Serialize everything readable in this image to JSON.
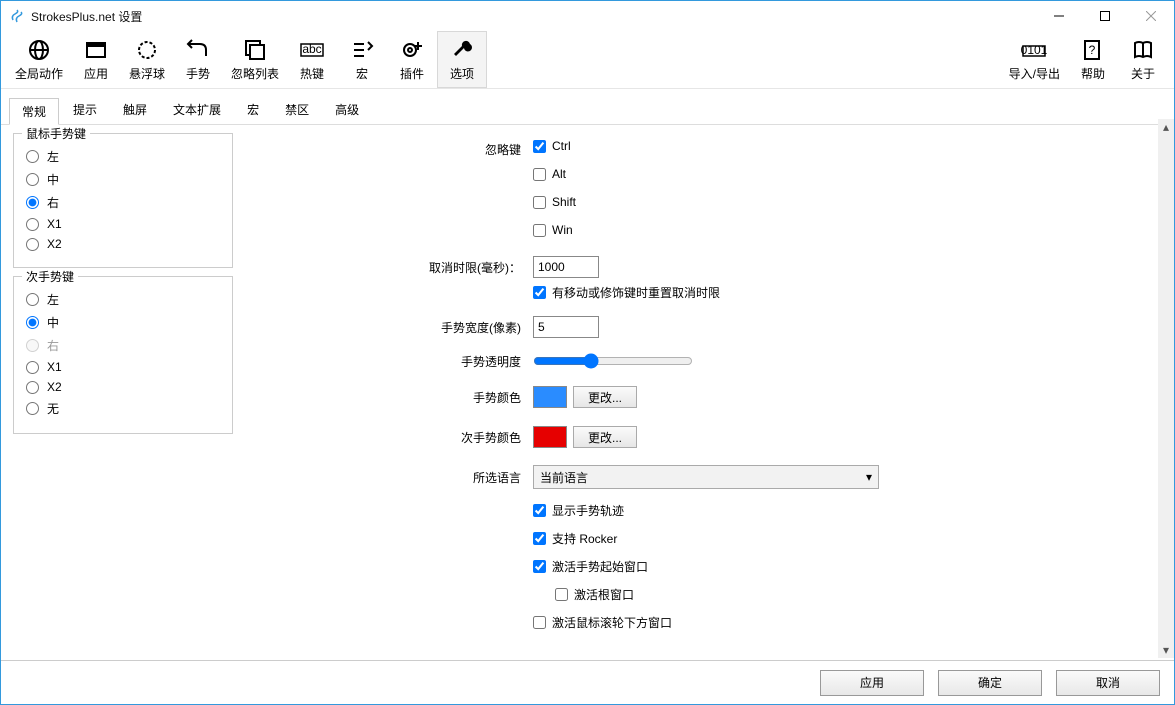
{
  "window": {
    "title": "StrokesPlus.net 设置"
  },
  "toolbar": {
    "global": "全局动作",
    "apps": "应用",
    "float": "悬浮球",
    "gestures": "手势",
    "ignore": "忽略列表",
    "hotkeys": "热键",
    "macros": "宏",
    "plugins": "插件",
    "options": "选项",
    "importexport": "导入/导出",
    "help": "帮助",
    "about": "关于"
  },
  "tabs": {
    "general": "常规",
    "hints": "提示",
    "touch": "触屏",
    "textexp": "文本扩展",
    "macro": "宏",
    "forbid": "禁区",
    "advanced": "高级"
  },
  "groups": {
    "primary": "鼠标手势键",
    "secondary": "次手势键"
  },
  "radios": {
    "left": "左",
    "middle": "中",
    "right": "右",
    "x1": "X1",
    "x2": "X2",
    "none": "无"
  },
  "labels": {
    "ignoreKey": "忽略键",
    "cancelTimeout": "取消时限(毫秒)：",
    "resetOnMove": "有移动或修饰键时重置取消时限",
    "gestureWidth": "手势宽度(像素)",
    "gestureOpacity": "手势透明度",
    "gestureColor": "手势颜色",
    "secColor": "次手势颜色",
    "language": "所选语言",
    "showTrail": "显示手势轨迹",
    "rocker": "支持 Rocker",
    "activateStart": "激活手势起始窗口",
    "activateRoot": "激活根窗口",
    "activateWheel": "激活鼠标滚轮下方窗口",
    "changeBtn": "更改...",
    "currentLang": "当前语言",
    "ctrl": "Ctrl",
    "alt": "Alt",
    "shift": "Shift",
    "win": "Win"
  },
  "values": {
    "cancelTimeout": "1000",
    "gestureWidth": "5",
    "gestureOpacity": 35,
    "color1": "#2a8cff",
    "color2": "#e60000"
  },
  "checks": {
    "ctrl": true,
    "alt": false,
    "shift": false,
    "win": false,
    "resetOnMove": true,
    "showTrail": true,
    "rocker": true,
    "activateStart": true,
    "activateRoot": false,
    "activateWheel": false
  },
  "primarySel": "right",
  "secondarySel": "middle",
  "footer": {
    "apply": "应用",
    "ok": "确定",
    "cancel": "取消"
  }
}
